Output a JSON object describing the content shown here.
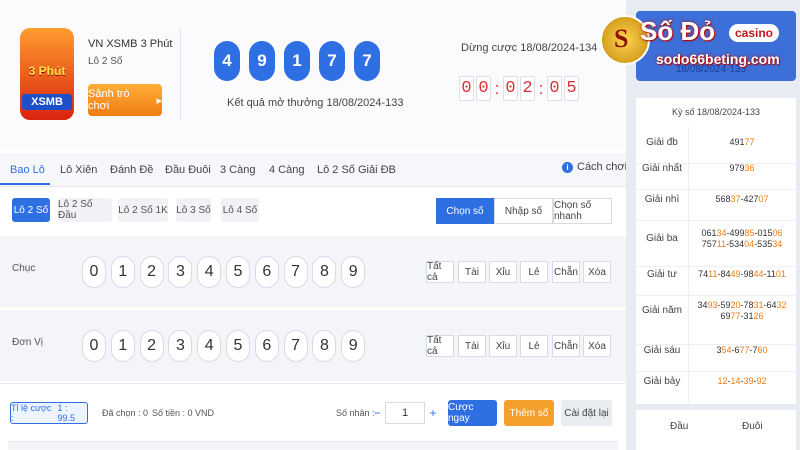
{
  "header": {
    "logo_line1": "3 Phút",
    "logo_line2": "XSMB",
    "game_name": "VN XSMB 3 Phút",
    "game_sub": "Lô 2 Số",
    "lobby_button": "Sảnh trò chơi",
    "result_balls": [
      "4",
      "9",
      "1",
      "7",
      "7"
    ],
    "result_text": "Kết quả mở thưởng 18/08/2024-133",
    "close_text": "Dừng cược 18/08/2024-134",
    "timer_digits": [
      "0",
      "0",
      "0",
      "2",
      "0",
      "5"
    ]
  },
  "tabs": [
    "Bao Lô",
    "Lô Xiên",
    "Đánh Đề",
    "Đầu Đuôi",
    "3 Càng",
    "4 Càng",
    "Lô 2 Số Giải ĐB"
  ],
  "active_tab": "Bao Lô",
  "rules_link": "Cách chơi",
  "subtabs": [
    "Lô 2 Số",
    "Lô 2 Số Đầu",
    "Lô 2 Số 1K",
    "Lô 3 Số",
    "Lô 4 Số"
  ],
  "modes": [
    "Chọn số",
    "Nhập số",
    "Chọn số nhanh"
  ],
  "rows": [
    {
      "label": "Chục",
      "numbers": [
        "0",
        "1",
        "2",
        "3",
        "4",
        "5",
        "6",
        "7",
        "8",
        "9"
      ]
    },
    {
      "label": "Đơn Vị",
      "numbers": [
        "0",
        "1",
        "2",
        "3",
        "4",
        "5",
        "6",
        "7",
        "8",
        "9"
      ]
    }
  ],
  "quick_buttons": [
    "Tất cả",
    "Tài",
    "Xỉu",
    "Lẻ",
    "Chẵn",
    "Xóa"
  ],
  "footer": {
    "ratio_label": "Tỉ lệ cược :",
    "ratio_value": "1 : 99.5",
    "selected": "Đã chọn : 0",
    "amount": "Số tiền : 0 VND",
    "multiplier_label": "Số nhân :",
    "multiplier_minus": "−",
    "multiplier_value": "1",
    "multiplier_plus": "+",
    "bet_now": "Cược ngay",
    "add_number": "Thêm số",
    "reset": "Cài đặt lại"
  },
  "brand": {
    "logo_char": "S",
    "name": "Số Đỏ",
    "casino": "casino",
    "url": "sodo66beting.com"
  },
  "right_panel": {
    "top_text": "18/08/2024-133",
    "draw_title": "Kỳ số 18/08/2024-133",
    "prizes": [
      {
        "label": "Giải đb",
        "value": [
          [
            "491",
            ""
          ],
          [
            "77",
            "hl"
          ]
        ]
      },
      {
        "label": "Giải nhất",
        "value": [
          [
            "979",
            ""
          ],
          [
            "36",
            "hl"
          ]
        ]
      },
      {
        "label": "Giải nhì",
        "value": [
          [
            "568",
            ""
          ],
          [
            "37",
            "hl"
          ],
          [
            "-427",
            ""
          ],
          [
            "07",
            "hl"
          ]
        ]
      },
      {
        "label": "Giải ba",
        "value": [
          [
            "061",
            ""
          ],
          [
            "34",
            "hl"
          ],
          [
            "-499",
            ""
          ],
          [
            "85",
            "hl"
          ],
          [
            "-015",
            ""
          ],
          [
            "06",
            "hl"
          ],
          [
            "\n",
            ""
          ],
          [
            "757",
            ""
          ],
          [
            "11",
            "hl"
          ],
          [
            "-534",
            ""
          ],
          [
            "04",
            "hl"
          ],
          [
            "-535",
            ""
          ],
          [
            "34",
            "hl"
          ]
        ]
      },
      {
        "label": "Giải tư",
        "value": [
          [
            "74",
            ""
          ],
          [
            "11",
            "hl"
          ],
          [
            "-84",
            ""
          ],
          [
            "49",
            "hl"
          ],
          [
            "-98",
            ""
          ],
          [
            "44",
            "hl"
          ],
          [
            "-11",
            ""
          ],
          [
            "01",
            "hl"
          ]
        ]
      },
      {
        "label": "Giải năm",
        "value": [
          [
            "34",
            ""
          ],
          [
            "93",
            "hl"
          ],
          [
            "-59",
            ""
          ],
          [
            "20",
            "hl"
          ],
          [
            "-78",
            ""
          ],
          [
            "31",
            "hl"
          ],
          [
            "-64",
            ""
          ],
          [
            "32",
            "hl"
          ],
          [
            "\n",
            ""
          ],
          [
            "69",
            ""
          ],
          [
            "77",
            "hl"
          ],
          [
            "-31",
            ""
          ],
          [
            "26",
            "hl"
          ]
        ]
      },
      {
        "label": "Giải sáu",
        "value": [
          [
            "3",
            ""
          ],
          [
            "54",
            "hl"
          ],
          [
            "-6",
            ""
          ],
          [
            "77",
            "hl"
          ],
          [
            "-7",
            ""
          ],
          [
            "60",
            "hl"
          ]
        ]
      },
      {
        "label": "Giải bảy",
        "value": [
          [
            "12",
            "hl"
          ],
          [
            "-",
            ""
          ],
          [
            "14",
            "hl"
          ],
          [
            "-",
            ""
          ],
          [
            "39",
            "hl"
          ],
          [
            "-",
            ""
          ],
          [
            "92",
            "hl"
          ]
        ]
      }
    ],
    "bottom_head": [
      "Đầu",
      "Đuôi"
    ]
  },
  "colors": {
    "accent": "#2f6fe4",
    "orange": "#f07c12",
    "timer_red": "#d8323a",
    "brand_red": "#c4161c"
  }
}
